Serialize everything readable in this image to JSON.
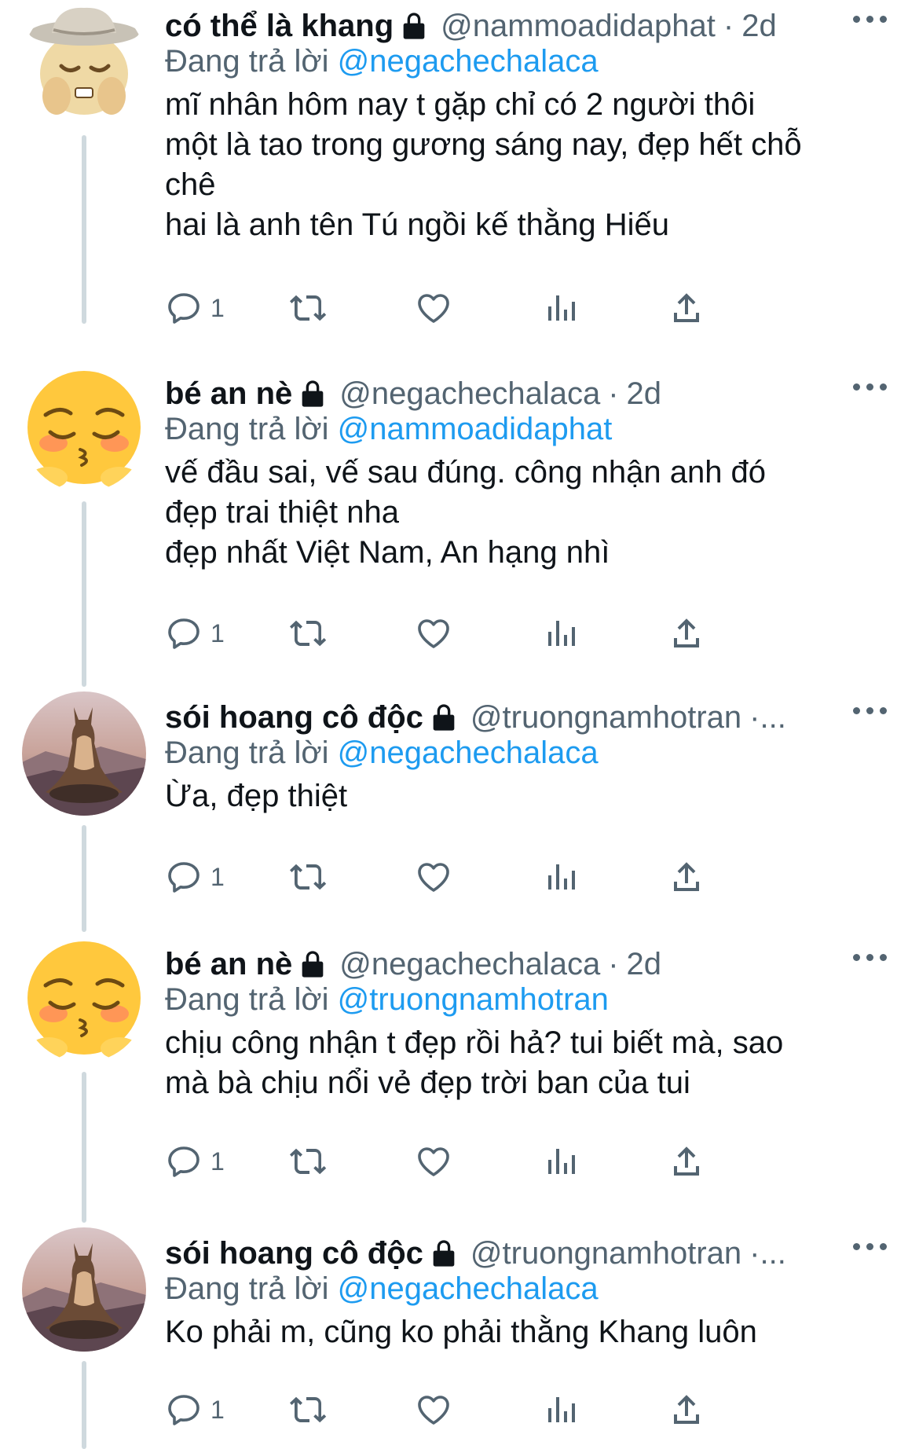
{
  "tweets": [
    {
      "name": "có thể là khang",
      "handle": "@nammoadidaphat",
      "dot": "·",
      "time": "2d",
      "replying_prefix": "Đang trả lời",
      "replying_to": "@negachechalaca",
      "avatar": "cowboy-emoji-avatar",
      "lines": [
        "mĩ nhân hôm nay t gặp chỉ có 2 người thôi",
        "một là tao trong gương sáng nay, đẹp hết chỗ",
        "chê",
        "hai là anh tên Tú ngồi kế thằng Hiếu"
      ],
      "reply_count": "1"
    },
    {
      "name": "bé an nè",
      "handle": "@negachechalaca",
      "dot": "·",
      "time": "2d",
      "replying_prefix": "Đang trả lời",
      "replying_to": "@nammoadidaphat",
      "avatar": "pleading-emoji-avatar",
      "lines": [
        "vế đầu sai, vế sau đúng. công nhận anh đó",
        "đẹp trai thiệt nha",
        "đẹp nhất Việt Nam, An hạng nhì"
      ],
      "reply_count": "1"
    },
    {
      "name": "sói hoang cô độc",
      "handle": "@truongnamhotran",
      "dot": "·...",
      "time": "",
      "replying_prefix": "Đang trả lời",
      "replying_to": "@negachechalaca",
      "avatar": "wolf-meditating-avatar",
      "lines": [
        "Ừa, đẹp thiệt"
      ],
      "reply_count": "1"
    },
    {
      "name": "bé an nè",
      "handle": "@negachechalaca",
      "dot": "·",
      "time": "2d",
      "replying_prefix": "Đang trả lời",
      "replying_to": "@truongnamhotran",
      "avatar": "pleading-emoji-avatar",
      "lines": [
        "chịu công nhận t đẹp rồi hả? tui biết mà, sao",
        "mà bà chịu nổi vẻ đẹp trời ban của tui"
      ],
      "reply_count": "1"
    },
    {
      "name": "sói hoang cô độc",
      "handle": "@truongnamhotran",
      "dot": "·...",
      "time": "",
      "replying_prefix": "Đang trả lời",
      "replying_to": "@negachechalaca",
      "avatar": "wolf-meditating-avatar",
      "lines": [
        "Ko phải m, cũng ko phải thằng Khang luôn"
      ],
      "reply_count": "1"
    }
  ],
  "icons": {
    "lock": "lock-icon",
    "more": "more-dots-icon",
    "reply": "reply-bubble-icon",
    "retweet": "retweet-icon",
    "like": "heart-icon",
    "views": "analytics-bars-icon",
    "share": "share-upload-icon"
  },
  "colors": {
    "text": "#0f1419",
    "muted": "#536471",
    "mention": "#1d9bf0",
    "thread_line": "#cfd9de"
  }
}
